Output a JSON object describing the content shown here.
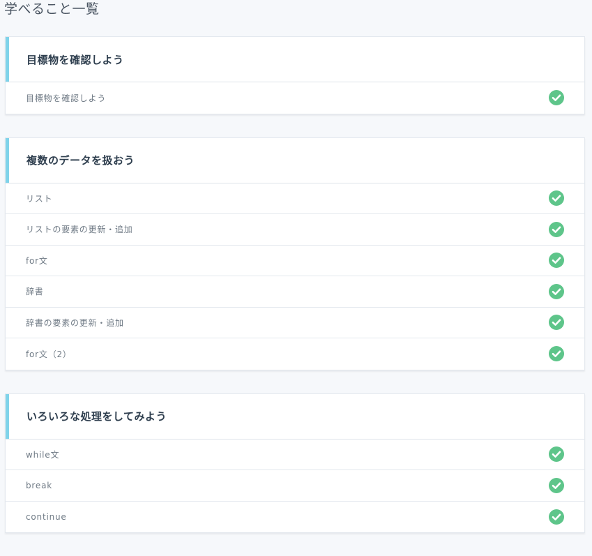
{
  "page": {
    "title": "学べること一覧"
  },
  "colors": {
    "accent_bar": "#7fd3ea",
    "check_green": "#5ec58a"
  },
  "sections": [
    {
      "title": "目標物を確認しよう",
      "lessons": [
        {
          "label": "目標物を確認しよう",
          "status_icon": "check-circle-icon",
          "completed": true
        }
      ]
    },
    {
      "title": "複数のデータを扱おう",
      "lessons": [
        {
          "label": "リスト",
          "status_icon": "check-circle-icon",
          "completed": true
        },
        {
          "label": "リストの要素の更新・追加",
          "status_icon": "check-circle-icon",
          "completed": true
        },
        {
          "label": "for文",
          "status_icon": "check-circle-icon",
          "completed": true
        },
        {
          "label": "辞書",
          "status_icon": "check-circle-icon",
          "completed": true
        },
        {
          "label": "辞書の要素の更新・追加",
          "status_icon": "check-circle-icon",
          "completed": true
        },
        {
          "label": "for文（2）",
          "status_icon": "check-circle-icon",
          "completed": true
        }
      ]
    },
    {
      "title": "いろいろな処理をしてみよう",
      "lessons": [
        {
          "label": "while文",
          "status_icon": "check-circle-icon",
          "completed": true
        },
        {
          "label": "break",
          "status_icon": "check-circle-icon",
          "completed": true
        },
        {
          "label": "continue",
          "status_icon": "check-circle-icon",
          "completed": true
        }
      ]
    }
  ]
}
